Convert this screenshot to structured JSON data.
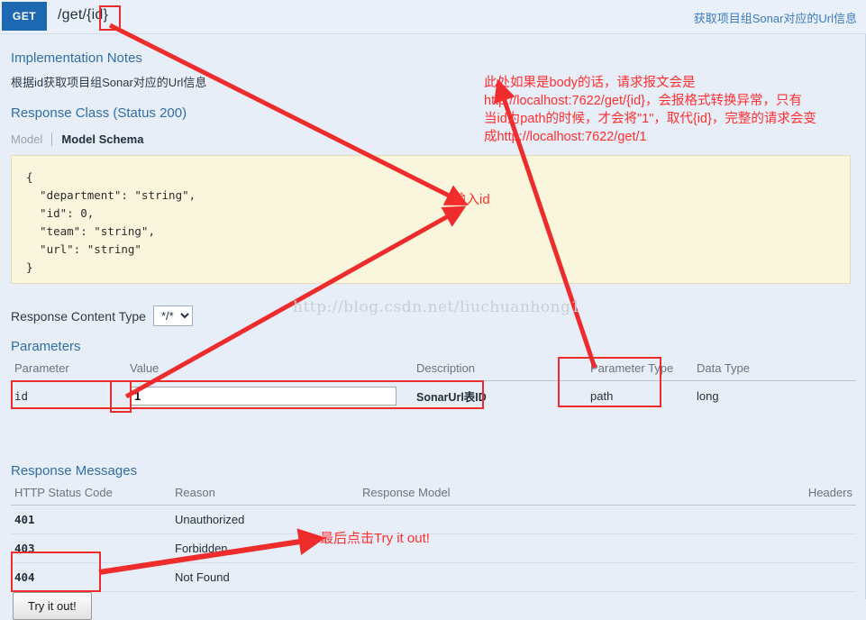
{
  "header": {
    "method": "GET",
    "path": "/get/{id}",
    "summary": "获取项目组Sonar对应的Url信息"
  },
  "implementation_notes": {
    "title": "Implementation Notes",
    "body": "根据id获取项目组Sonar对应的Url信息"
  },
  "response_class": {
    "title": "Response Class (Status 200)",
    "tab_model": "Model",
    "tab_model_schema": "Model Schema",
    "schema": "{\n  \"department\": \"string\",\n  \"id\": 0,\n  \"team\": \"string\",\n  \"url\": \"string\"\n}"
  },
  "response_content_type": {
    "label": "Response Content Type",
    "selected": "*/*",
    "options": [
      "*/*"
    ]
  },
  "parameters": {
    "title": "Parameters",
    "columns": [
      "Parameter",
      "Value",
      "Description",
      "Parameter Type",
      "Data Type"
    ],
    "rows": [
      {
        "name": "id",
        "value": "1",
        "value_placeholder": "",
        "description": "SonarUrl表ID",
        "param_type": "path",
        "data_type": "long"
      }
    ]
  },
  "response_messages": {
    "title": "Response Messages",
    "columns": [
      "HTTP Status Code",
      "Reason",
      "Response Model",
      "Headers"
    ],
    "rows": [
      {
        "code": "401",
        "reason": "Unauthorized",
        "model": "",
        "headers": ""
      },
      {
        "code": "403",
        "reason": "Forbidden",
        "model": "",
        "headers": ""
      },
      {
        "code": "404",
        "reason": "Not Found",
        "model": "",
        "headers": ""
      }
    ]
  },
  "actions": {
    "try_it_out": "Try it out!"
  },
  "annotations": {
    "note_body": "此处如果是body的话，请求报文会是\nhttp://localhost:7622/get/{id}，会报格式转换异常，只有\n当id为path的时候，才会将\"1\"，取代{id}，完整的请求会变\n成http://localhost:7622/get/1",
    "note_input_id": "输入id",
    "note_click_try": "最后点击Try it out!",
    "color": "#ff2f2f"
  },
  "watermark": "http://blog.csdn.net/liuchuanhong1"
}
